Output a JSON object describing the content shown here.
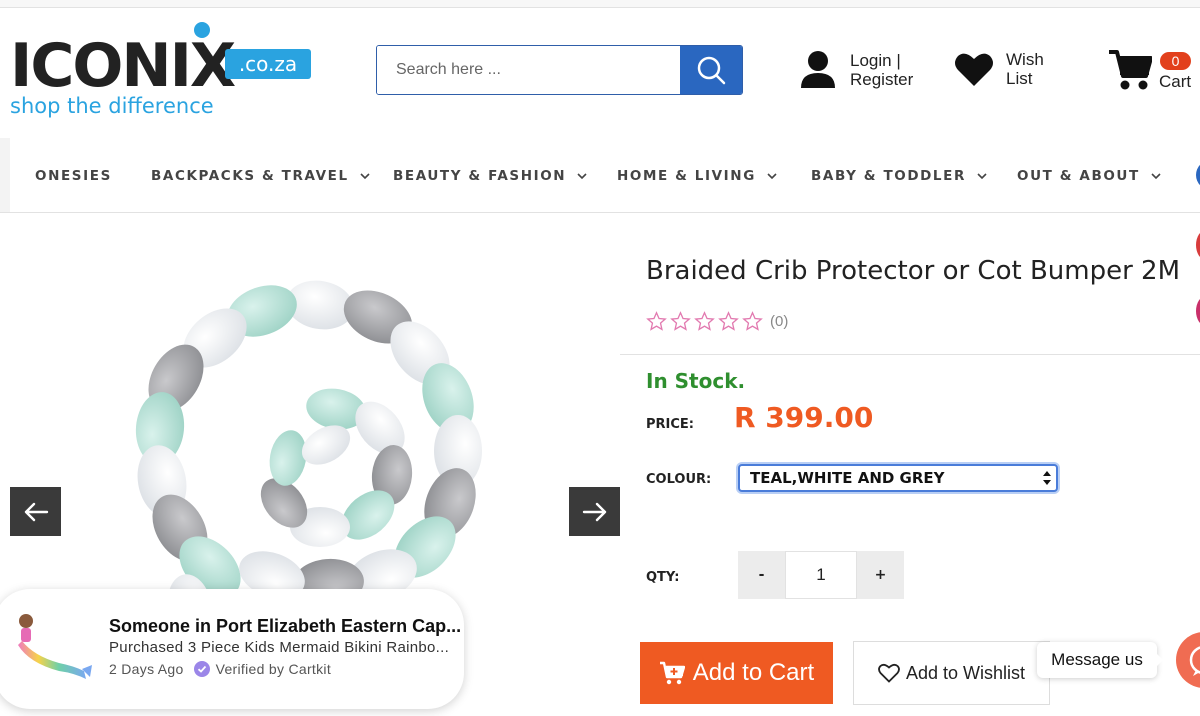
{
  "brand": {
    "name": "ICONIX",
    "tld": ".co.za",
    "tagline": "shop the difference",
    "color": "#2aa3e0"
  },
  "search": {
    "placeholder": "Search here ..."
  },
  "header": {
    "login_line1": "Login |",
    "login_line2": "Register",
    "wish_line1": "Wish",
    "wish_line2": "List",
    "cart_count": "0",
    "cart_label": "Cart"
  },
  "nav": {
    "items": [
      {
        "label": "ONESIES",
        "dropdown": false
      },
      {
        "label": "BACKPACKS & TRAVEL",
        "dropdown": true
      },
      {
        "label": "BEAUTY & FASHION",
        "dropdown": true
      },
      {
        "label": "HOME & LIVING",
        "dropdown": true
      },
      {
        "label": "BABY & TODDLER",
        "dropdown": true
      },
      {
        "label": "OUT & ABOUT",
        "dropdown": true
      }
    ]
  },
  "product": {
    "title": "Braided Crib Protector or Cot Bumper 2M",
    "rating_stars": 0,
    "rating_count": "(0)",
    "stock": "In Stock.",
    "price_label": "PRICE:",
    "price": "R 399.00",
    "colour_label": "COLOUR:",
    "colour_value": "TEAL,WHITE AND GREY",
    "qty_label": "QTY:",
    "qty_minus": "-",
    "qty_value": "1",
    "qty_plus": "+",
    "add_to_cart": "Add to Cart",
    "add_to_wishlist": "Add to Wishlist"
  },
  "toast": {
    "title": "Someone in Port Elizabeth Eastern Cap...",
    "subtitle": "Purchased 3 Piece Kids Mermaid Bikini Rainbo...",
    "time": "2 Days Ago",
    "verified": "Verified by Cartkit"
  },
  "chat": {
    "label": "Message us"
  },
  "colors": {
    "accent_orange": "#ef5a22",
    "stock_green": "#2f8f2f",
    "search_blue": "#2a67c0"
  }
}
